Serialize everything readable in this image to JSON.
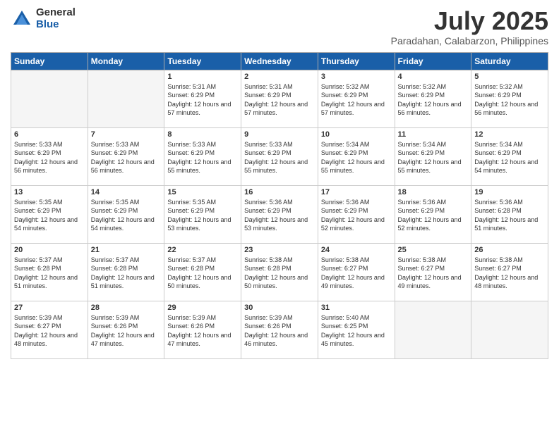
{
  "logo": {
    "general": "General",
    "blue": "Blue"
  },
  "title": "July 2025",
  "subtitle": "Paradahan, Calabarzon, Philippines",
  "headers": [
    "Sunday",
    "Monday",
    "Tuesday",
    "Wednesday",
    "Thursday",
    "Friday",
    "Saturday"
  ],
  "weeks": [
    [
      {
        "num": "",
        "sunrise": "",
        "sunset": "",
        "daylight": "",
        "empty": true
      },
      {
        "num": "",
        "sunrise": "",
        "sunset": "",
        "daylight": "",
        "empty": true
      },
      {
        "num": "1",
        "sunrise": "Sunrise: 5:31 AM",
        "sunset": "Sunset: 6:29 PM",
        "daylight": "Daylight: 12 hours and 57 minutes.",
        "empty": false
      },
      {
        "num": "2",
        "sunrise": "Sunrise: 5:31 AM",
        "sunset": "Sunset: 6:29 PM",
        "daylight": "Daylight: 12 hours and 57 minutes.",
        "empty": false
      },
      {
        "num": "3",
        "sunrise": "Sunrise: 5:32 AM",
        "sunset": "Sunset: 6:29 PM",
        "daylight": "Daylight: 12 hours and 57 minutes.",
        "empty": false
      },
      {
        "num": "4",
        "sunrise": "Sunrise: 5:32 AM",
        "sunset": "Sunset: 6:29 PM",
        "daylight": "Daylight: 12 hours and 56 minutes.",
        "empty": false
      },
      {
        "num": "5",
        "sunrise": "Sunrise: 5:32 AM",
        "sunset": "Sunset: 6:29 PM",
        "daylight": "Daylight: 12 hours and 56 minutes.",
        "empty": false
      }
    ],
    [
      {
        "num": "6",
        "sunrise": "Sunrise: 5:33 AM",
        "sunset": "Sunset: 6:29 PM",
        "daylight": "Daylight: 12 hours and 56 minutes.",
        "empty": false
      },
      {
        "num": "7",
        "sunrise": "Sunrise: 5:33 AM",
        "sunset": "Sunset: 6:29 PM",
        "daylight": "Daylight: 12 hours and 56 minutes.",
        "empty": false
      },
      {
        "num": "8",
        "sunrise": "Sunrise: 5:33 AM",
        "sunset": "Sunset: 6:29 PM",
        "daylight": "Daylight: 12 hours and 55 minutes.",
        "empty": false
      },
      {
        "num": "9",
        "sunrise": "Sunrise: 5:33 AM",
        "sunset": "Sunset: 6:29 PM",
        "daylight": "Daylight: 12 hours and 55 minutes.",
        "empty": false
      },
      {
        "num": "10",
        "sunrise": "Sunrise: 5:34 AM",
        "sunset": "Sunset: 6:29 PM",
        "daylight": "Daylight: 12 hours and 55 minutes.",
        "empty": false
      },
      {
        "num": "11",
        "sunrise": "Sunrise: 5:34 AM",
        "sunset": "Sunset: 6:29 PM",
        "daylight": "Daylight: 12 hours and 55 minutes.",
        "empty": false
      },
      {
        "num": "12",
        "sunrise": "Sunrise: 5:34 AM",
        "sunset": "Sunset: 6:29 PM",
        "daylight": "Daylight: 12 hours and 54 minutes.",
        "empty": false
      }
    ],
    [
      {
        "num": "13",
        "sunrise": "Sunrise: 5:35 AM",
        "sunset": "Sunset: 6:29 PM",
        "daylight": "Daylight: 12 hours and 54 minutes.",
        "empty": false
      },
      {
        "num": "14",
        "sunrise": "Sunrise: 5:35 AM",
        "sunset": "Sunset: 6:29 PM",
        "daylight": "Daylight: 12 hours and 54 minutes.",
        "empty": false
      },
      {
        "num": "15",
        "sunrise": "Sunrise: 5:35 AM",
        "sunset": "Sunset: 6:29 PM",
        "daylight": "Daylight: 12 hours and 53 minutes.",
        "empty": false
      },
      {
        "num": "16",
        "sunrise": "Sunrise: 5:36 AM",
        "sunset": "Sunset: 6:29 PM",
        "daylight": "Daylight: 12 hours and 53 minutes.",
        "empty": false
      },
      {
        "num": "17",
        "sunrise": "Sunrise: 5:36 AM",
        "sunset": "Sunset: 6:29 PM",
        "daylight": "Daylight: 12 hours and 52 minutes.",
        "empty": false
      },
      {
        "num": "18",
        "sunrise": "Sunrise: 5:36 AM",
        "sunset": "Sunset: 6:29 PM",
        "daylight": "Daylight: 12 hours and 52 minutes.",
        "empty": false
      },
      {
        "num": "19",
        "sunrise": "Sunrise: 5:36 AM",
        "sunset": "Sunset: 6:28 PM",
        "daylight": "Daylight: 12 hours and 51 minutes.",
        "empty": false
      }
    ],
    [
      {
        "num": "20",
        "sunrise": "Sunrise: 5:37 AM",
        "sunset": "Sunset: 6:28 PM",
        "daylight": "Daylight: 12 hours and 51 minutes.",
        "empty": false
      },
      {
        "num": "21",
        "sunrise": "Sunrise: 5:37 AM",
        "sunset": "Sunset: 6:28 PM",
        "daylight": "Daylight: 12 hours and 51 minutes.",
        "empty": false
      },
      {
        "num": "22",
        "sunrise": "Sunrise: 5:37 AM",
        "sunset": "Sunset: 6:28 PM",
        "daylight": "Daylight: 12 hours and 50 minutes.",
        "empty": false
      },
      {
        "num": "23",
        "sunrise": "Sunrise: 5:38 AM",
        "sunset": "Sunset: 6:28 PM",
        "daylight": "Daylight: 12 hours and 50 minutes.",
        "empty": false
      },
      {
        "num": "24",
        "sunrise": "Sunrise: 5:38 AM",
        "sunset": "Sunset: 6:27 PM",
        "daylight": "Daylight: 12 hours and 49 minutes.",
        "empty": false
      },
      {
        "num": "25",
        "sunrise": "Sunrise: 5:38 AM",
        "sunset": "Sunset: 6:27 PM",
        "daylight": "Daylight: 12 hours and 49 minutes.",
        "empty": false
      },
      {
        "num": "26",
        "sunrise": "Sunrise: 5:38 AM",
        "sunset": "Sunset: 6:27 PM",
        "daylight": "Daylight: 12 hours and 48 minutes.",
        "empty": false
      }
    ],
    [
      {
        "num": "27",
        "sunrise": "Sunrise: 5:39 AM",
        "sunset": "Sunset: 6:27 PM",
        "daylight": "Daylight: 12 hours and 48 minutes.",
        "empty": false
      },
      {
        "num": "28",
        "sunrise": "Sunrise: 5:39 AM",
        "sunset": "Sunset: 6:26 PM",
        "daylight": "Daylight: 12 hours and 47 minutes.",
        "empty": false
      },
      {
        "num": "29",
        "sunrise": "Sunrise: 5:39 AM",
        "sunset": "Sunset: 6:26 PM",
        "daylight": "Daylight: 12 hours and 47 minutes.",
        "empty": false
      },
      {
        "num": "30",
        "sunrise": "Sunrise: 5:39 AM",
        "sunset": "Sunset: 6:26 PM",
        "daylight": "Daylight: 12 hours and 46 minutes.",
        "empty": false
      },
      {
        "num": "31",
        "sunrise": "Sunrise: 5:40 AM",
        "sunset": "Sunset: 6:25 PM",
        "daylight": "Daylight: 12 hours and 45 minutes.",
        "empty": false
      },
      {
        "num": "",
        "sunrise": "",
        "sunset": "",
        "daylight": "",
        "empty": true
      },
      {
        "num": "",
        "sunrise": "",
        "sunset": "",
        "daylight": "",
        "empty": true
      }
    ]
  ]
}
